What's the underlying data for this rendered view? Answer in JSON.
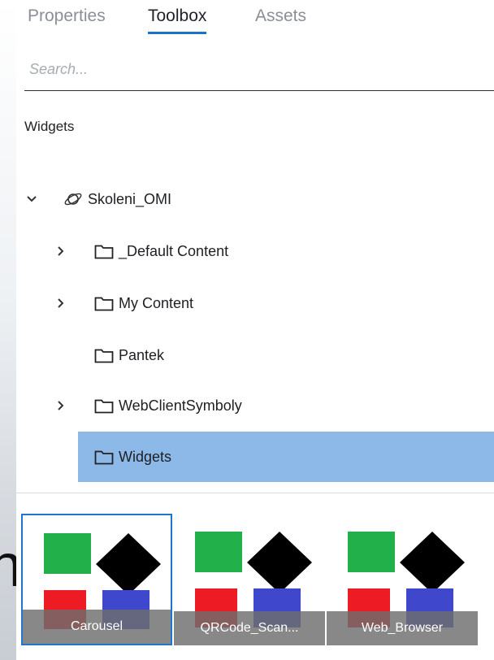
{
  "tabs": [
    {
      "label": "Properties",
      "active": false
    },
    {
      "label": "Toolbox",
      "active": true
    },
    {
      "label": "Assets",
      "active": false
    }
  ],
  "search": {
    "placeholder": "Search...",
    "value": ""
  },
  "section_title": "Widgets",
  "tree": {
    "root": {
      "label": "Skoleni_OMI",
      "icon": "planet-icon",
      "expanded": true
    },
    "items": [
      {
        "label": "_Default Content",
        "expandable": true,
        "icon": "folder-icon"
      },
      {
        "label": "My Content",
        "expandable": true,
        "icon": "folder-icon"
      },
      {
        "label": "Pantek",
        "expandable": false,
        "icon": "folder-icon"
      },
      {
        "label": "WebClientSymboly",
        "expandable": true,
        "icon": "folder-icon"
      },
      {
        "label": "Widgets",
        "expandable": false,
        "icon": "folder-icon",
        "selected": true
      }
    ]
  },
  "widgets": [
    {
      "label": "Carousel",
      "selected": true
    },
    {
      "label": "QRCode_Scan...",
      "selected": false
    },
    {
      "label": "Web_Browser",
      "selected": false
    }
  ],
  "colors": {
    "accent": "#1a73c7",
    "selection": "#8db9e9",
    "green": "#22b04b",
    "red": "#ed1c24",
    "blue": "#3f48cc",
    "black": "#000000"
  },
  "background_glyph": "n"
}
